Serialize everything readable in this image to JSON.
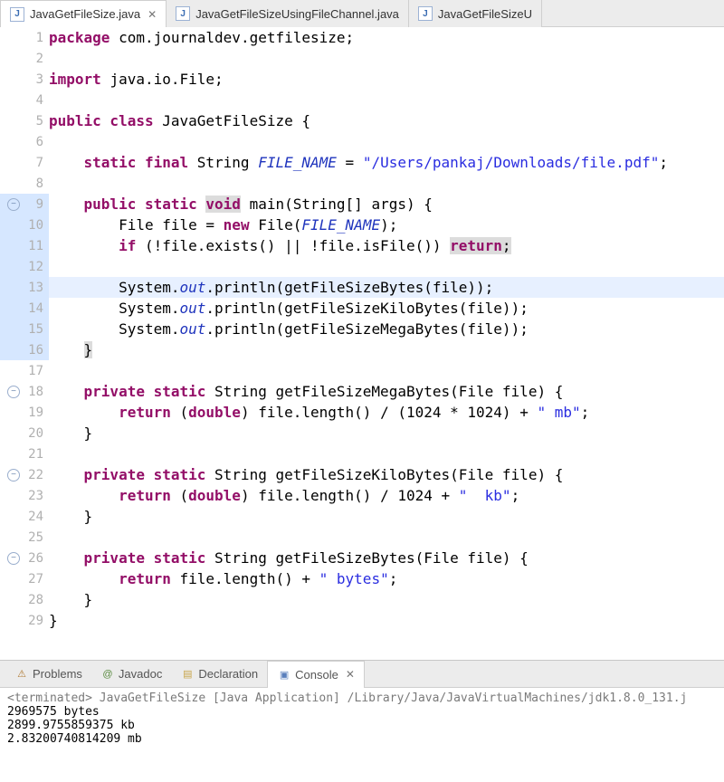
{
  "tabs": [
    {
      "label": "JavaGetFileSize.java",
      "active": true
    },
    {
      "label": "JavaGetFileSizeUsingFileChannel.java",
      "active": false
    },
    {
      "label": "JavaGetFileSizeU",
      "active": false
    }
  ],
  "close_glyph": "✕",
  "fold_glyph": "−",
  "code_lines": [
    {
      "n": 1,
      "html": "<span class='kw'>package</span> <span class='plain'>com.journaldev.getfilesize;</span>"
    },
    {
      "n": 2,
      "html": ""
    },
    {
      "n": 3,
      "html": "<span class='kw'>import</span> <span class='plain'>java.io.File;</span>"
    },
    {
      "n": 4,
      "html": ""
    },
    {
      "n": 5,
      "html": "<span class='kw'>public class</span> <span class='plain'>JavaGetFileSize {</span>"
    },
    {
      "n": 6,
      "html": ""
    },
    {
      "n": 7,
      "html": "    <span class='kw'>static final</span> <span class='plain'>String</span> <span class='const'>FILE_NAME</span> <span class='plain'>=</span> <span class='str'>\"/Users/pankaj/Downloads/file.pdf\"</span><span class='plain'>;</span>"
    },
    {
      "n": 8,
      "html": ""
    },
    {
      "n": 9,
      "block": true,
      "fold": true,
      "html": "    <span class='kw'>public static</span> <span class='kw hl'>void</span> <span class='plain'>main(String[] args) {</span>"
    },
    {
      "n": 10,
      "block": true,
      "html": "        <span class='plain'>File file =</span> <span class='kw'>new</span> <span class='plain'>File(</span><span class='const'>FILE_NAME</span><span class='plain'>);</span>"
    },
    {
      "n": 11,
      "block": true,
      "html": "        <span class='kw'>if</span> <span class='plain'>(!file.exists() || !file.isFile())</span> <span class='kw hl'>return</span><span class='plain hl'>;</span>"
    },
    {
      "n": 12,
      "block": true,
      "html": ""
    },
    {
      "n": 13,
      "block": true,
      "current": true,
      "html": "        <span class='plain'>System.</span><span class='fld'>out</span><span class='plain'>.println(</span><span class='plain'>getFileSizeBytes</span><span class='plain'>(file));</span>"
    },
    {
      "n": 14,
      "block": true,
      "html": "        <span class='plain'>System.</span><span class='fld'>out</span><span class='plain'>.println(</span><span class='plain'>getFileSizeKiloBytes</span><span class='plain'>(file));</span>"
    },
    {
      "n": 15,
      "block": true,
      "html": "        <span class='plain'>System.</span><span class='fld'>out</span><span class='plain'>.println(</span><span class='plain'>getFileSizeMegaBytes</span><span class='plain'>(file));</span>"
    },
    {
      "n": 16,
      "block": true,
      "html": "    <span class='plain hl'>}</span>"
    },
    {
      "n": 17,
      "html": ""
    },
    {
      "n": 18,
      "fold": true,
      "html": "    <span class='kw'>private static</span> <span class='plain'>String getFileSizeMegaBytes(File file) {</span>"
    },
    {
      "n": 19,
      "html": "        <span class='kw'>return</span> <span class='plain'>(</span><span class='kw'>double</span><span class='plain'>) file.length() / (1024 * 1024) +</span> <span class='str'>\" mb\"</span><span class='plain'>;</span>"
    },
    {
      "n": 20,
      "html": "    <span class='plain'>}</span>"
    },
    {
      "n": 21,
      "html": ""
    },
    {
      "n": 22,
      "fold": true,
      "html": "    <span class='kw'>private static</span> <span class='plain'>String getFileSizeKiloBytes(File file) {</span>"
    },
    {
      "n": 23,
      "html": "        <span class='kw'>return</span> <span class='plain'>(</span><span class='kw'>double</span><span class='plain'>) file.length() / 1024 +</span> <span class='str'>\"  kb\"</span><span class='plain'>;</span>"
    },
    {
      "n": 24,
      "html": "    <span class='plain'>}</span>"
    },
    {
      "n": 25,
      "html": ""
    },
    {
      "n": 26,
      "fold": true,
      "html": "    <span class='kw'>private static</span> <span class='plain'>String getFileSizeBytes(File file) {</span>"
    },
    {
      "n": 27,
      "html": "        <span class='kw'>return</span> <span class='plain'>file.length() +</span> <span class='str'>\" bytes\"</span><span class='plain'>;</span>"
    },
    {
      "n": 28,
      "html": "    <span class='plain'>}</span>"
    },
    {
      "n": 29,
      "html": "<span class='plain'>}</span>"
    }
  ],
  "panel_tabs": {
    "problems": "Problems",
    "javadoc": "Javadoc",
    "declaration": "Declaration",
    "console": "Console"
  },
  "console": {
    "header": "<terminated> JavaGetFileSize [Java Application] /Library/Java/JavaVirtualMachines/jdk1.8.0_131.j",
    "lines": [
      "2969575 bytes",
      "2899.9755859375  kb",
      "2.83200740814209 mb"
    ]
  }
}
